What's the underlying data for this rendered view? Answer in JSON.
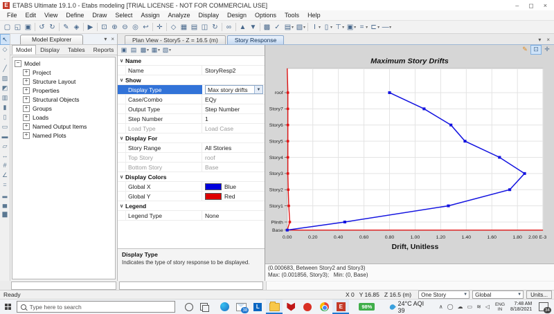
{
  "titlebar": {
    "app_initial": "E",
    "title": "ETABS Ultimate 19.1.0 - Etabs modeling [TRIAL LICENSE - NOT FOR COMMERCIAL USE]",
    "minimize": "–",
    "maximize": "◻",
    "close": "×"
  },
  "menubar": {
    "items": [
      "File",
      "Edit",
      "View",
      "Define",
      "Draw",
      "Select",
      "Assign",
      "Analyze",
      "Display",
      "Design",
      "Options",
      "Tools",
      "Help"
    ]
  },
  "toolbar": {
    "groups": [
      [
        {
          "name": "new-model",
          "g": "▢"
        },
        {
          "name": "open-file",
          "g": "◱"
        },
        {
          "name": "save",
          "g": "▣"
        }
      ],
      [
        {
          "name": "undo",
          "g": "↺"
        },
        {
          "name": "redo",
          "g": "↻"
        }
      ],
      [
        {
          "name": "draw-pencil",
          "g": "✎"
        },
        {
          "name": "lock-model",
          "g": "◈"
        }
      ],
      [
        {
          "name": "run-analysis",
          "g": "▶"
        }
      ],
      [
        {
          "name": "rubber-band-zoom",
          "g": "⊡"
        },
        {
          "name": "zoom-in",
          "g": "⊕"
        },
        {
          "name": "zoom-out",
          "g": "⊖"
        },
        {
          "name": "zoom-full",
          "g": "◎"
        },
        {
          "name": "zoom-previous",
          "g": "↩"
        }
      ],
      [
        {
          "name": "pan",
          "g": "✛"
        }
      ],
      [
        {
          "name": "view-3d",
          "g": "◇"
        },
        {
          "name": "plan-view",
          "g": "▦"
        },
        {
          "name": "elevation-view",
          "g": "▤"
        },
        {
          "name": "nd-view",
          "g": "◫"
        },
        {
          "name": "rotate-view",
          "g": "↻"
        }
      ],
      [
        {
          "name": "object-view-options",
          "g": "∞"
        }
      ],
      [
        {
          "name": "move-up-in-list",
          "g": "▲"
        },
        {
          "name": "move-down-in-list",
          "g": "▼"
        }
      ],
      [
        {
          "name": "set-display-options",
          "g": "▩"
        },
        {
          "name": "check-model",
          "g": "✓"
        },
        {
          "name": "show-sheet",
          "g": "▤",
          "caret": true
        },
        {
          "name": "more-display",
          "g": "▧",
          "caret": true
        }
      ],
      [
        {
          "name": "i-section",
          "g": "I",
          "caret": true
        },
        {
          "name": "rect-section",
          "g": "▯",
          "caret": true
        },
        {
          "name": "tee-section",
          "g": "⊤",
          "caret": true
        },
        {
          "name": "boxed-i-section",
          "g": "▣",
          "caret": true
        },
        {
          "name": "double-line",
          "g": "=",
          "caret": true
        },
        {
          "name": "channel-section",
          "g": "⊏",
          "caret": true
        },
        {
          "name": "single-line",
          "g": "—",
          "caret": true
        }
      ]
    ]
  },
  "draw_toolbar": {
    "items": [
      {
        "name": "select-pointer",
        "g": "↖",
        "active": true
      },
      {
        "name": "reshape-object",
        "g": "◇"
      },
      {
        "name": "draw-joint",
        "g": "·"
      },
      {
        "name": "draw-frame",
        "g": "╱"
      },
      {
        "name": "quick-draw-frame",
        "g": "▨"
      },
      {
        "name": "quick-draw-braces",
        "g": "◩"
      },
      {
        "name": "quick-draw-secondary-beams",
        "g": "▥"
      },
      {
        "name": "draw-wall",
        "g": "▮"
      },
      {
        "name": "quick-draw-wall",
        "g": "▯"
      },
      {
        "name": "draw-floor",
        "g": "▭"
      },
      {
        "name": "quick-draw-floor",
        "g": "▬"
      },
      {
        "name": "draw-null-area",
        "g": "▱"
      },
      {
        "name": "draw-dimension-line",
        "g": "↔"
      },
      {
        "name": "draw-grid",
        "g": "#"
      },
      {
        "name": "section-cut",
        "g": "∠"
      },
      {
        "name": "measure-tool",
        "g": "="
      },
      {
        "name": "story-plot-1",
        "g": "▂"
      },
      {
        "name": "story-plot-2",
        "g": "▄"
      },
      {
        "name": "story-plot-3",
        "g": "▆"
      }
    ]
  },
  "explorer": {
    "title": "Model Explorer",
    "dropdown": "▾",
    "close": "×",
    "tabs": [
      {
        "label": "Model",
        "active": true
      },
      {
        "label": "Display",
        "active": false
      },
      {
        "label": "Tables",
        "active": false
      },
      {
        "label": "Reports",
        "active": false
      }
    ],
    "tree": {
      "root": "Model",
      "children": [
        "Project",
        "Structure Layout",
        "Properties",
        "Structural Objects",
        "Groups",
        "Loads",
        "Named Output Items",
        "Named Plots"
      ]
    }
  },
  "doc_tabs": {
    "tabs": [
      {
        "label": "Plan View - Story5 - Z = 16.5 (m)",
        "active": false
      },
      {
        "label": "Story Response",
        "active": true
      }
    ],
    "dropdown": "▾",
    "close": "×"
  },
  "props": {
    "mini_toolbar": [
      {
        "name": "save-plot",
        "g": "▣"
      },
      {
        "name": "print-plot",
        "g": "▤"
      },
      {
        "name": "capture-image",
        "g": "▩",
        "caret": true
      },
      {
        "name": "show-table",
        "g": "▦",
        "caret": true
      },
      {
        "name": "export-plot",
        "g": "▧",
        "caret": true
      }
    ],
    "rows": [
      {
        "t": "sec",
        "label": "Name"
      },
      {
        "t": "row",
        "label": "Name",
        "value": "StoryResp2"
      },
      {
        "t": "sec",
        "label": "Show"
      },
      {
        "t": "row",
        "label": "Display Type",
        "value": "Max story drifts",
        "selected": true,
        "dropdown": true
      },
      {
        "t": "row",
        "label": "Case/Combo",
        "value": "EQy"
      },
      {
        "t": "row",
        "label": "Output Type",
        "value": "Step Number"
      },
      {
        "t": "row",
        "label": "Step Number",
        "value": "1"
      },
      {
        "t": "row",
        "label": "Load Type",
        "value": "Load Case",
        "disabled": true
      },
      {
        "t": "sec",
        "label": "Display For"
      },
      {
        "t": "row",
        "label": "Story Range",
        "value": "All Stories"
      },
      {
        "t": "row",
        "label": "Top Story",
        "value": "roof",
        "disabled": true
      },
      {
        "t": "row",
        "label": "Bottom Story",
        "value": "Base",
        "disabled": true
      },
      {
        "t": "sec",
        "label": "Display Colors"
      },
      {
        "t": "row",
        "label": "Global X",
        "value": "Blue",
        "swatch": "#0000dd"
      },
      {
        "t": "row",
        "label": "Global Y",
        "value": "Red",
        "swatch": "#dd0000"
      },
      {
        "t": "sec",
        "label": "Legend"
      },
      {
        "t": "row",
        "label": "Legend Type",
        "value": "None"
      }
    ],
    "description": {
      "title": "Display Type",
      "text": "Indicates the type of story response to be displayed."
    }
  },
  "chart_tools": {
    "edit": "✎",
    "zoom": "⊡",
    "pan": "✛"
  },
  "chart_data": {
    "type": "line",
    "title": "Maximum Story Drifts",
    "xlabel": "Drift, Unitless",
    "x_unit": "E-3",
    "xlim": [
      0,
      2.0
    ],
    "x_ticks": [
      "0.00",
      "0.20",
      "0.40",
      "0.60",
      "0.80",
      "1.00",
      "1.20",
      "1.40",
      "1.60",
      "1.80",
      "2.00 E-3"
    ],
    "categories": [
      "roof",
      "Story7",
      "Story6",
      "Story5",
      "Story4",
      "Story3",
      "Story2",
      "Story1",
      "Plinth",
      "Base"
    ],
    "series": [
      {
        "name": "Global X",
        "color": "#1414e0",
        "values_e3": [
          0.8,
          1.07,
          1.28,
          1.39,
          1.66,
          1.856,
          1.74,
          1.26,
          0.45,
          0.0
        ]
      },
      {
        "name": "Global Y",
        "color": "#e01414",
        "values_e3": [
          0.005,
          0.005,
          0.005,
          0.005,
          0.005,
          0.005,
          0.008,
          0.012,
          0.02,
          0.0
        ]
      }
    ],
    "legend": "none",
    "grid": true,
    "status_line1": "(0.000683, Between Story2 and Story3)",
    "status_line2": "Max: (0.001856, Story3);   Min: (0, Base)"
  },
  "statusbar": {
    "ready": "Ready",
    "coords": "X 0   Y 16.85   Z 16.5 (m)",
    "story_mode": "One Story",
    "coord_system": "Global",
    "units_label": "Units..."
  },
  "taskbar": {
    "search_placeholder": "Type here to search",
    "apps": [
      {
        "name": "edge"
      },
      {
        "name": "mail",
        "badge": "38"
      },
      {
        "name": "l-app",
        "label": "L"
      },
      {
        "name": "file-explorer",
        "active": true
      },
      {
        "name": "mcafee"
      },
      {
        "name": "red-app"
      },
      {
        "name": "chrome"
      },
      {
        "name": "etabs",
        "label": "E",
        "active": true
      }
    ],
    "battery": "98%",
    "weather": "24°C  AQI 39",
    "tray": [
      {
        "name": "chevron-up",
        "g": "∧"
      },
      {
        "name": "people",
        "g": "◯"
      },
      {
        "name": "onedrive",
        "g": "☁"
      },
      {
        "name": "battery-tray",
        "g": "▭"
      },
      {
        "name": "wifi",
        "g": "≋"
      },
      {
        "name": "volume",
        "g": "◁"
      }
    ],
    "lang_line1": "ENG",
    "lang_line2": "IN",
    "time": "7:48 AM",
    "date": "8/18/2021",
    "notification_count": "34"
  }
}
